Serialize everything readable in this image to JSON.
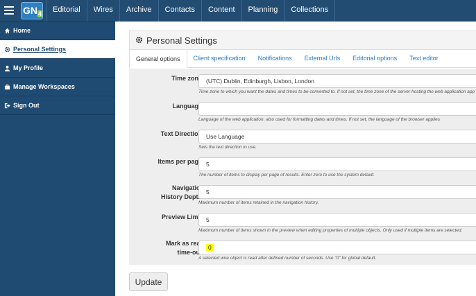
{
  "nav": {
    "logo": "GN",
    "logo_badge": "4",
    "items": [
      "Editorial",
      "Wires",
      "Archive",
      "Contacts",
      "Content",
      "Planning",
      "Collections"
    ]
  },
  "sidebar": {
    "items": [
      {
        "label": "Home",
        "icon": "home-icon"
      },
      {
        "label": "Personal Settings",
        "icon": "gear-icon",
        "active": true
      },
      {
        "label": "My Profile",
        "icon": "user-icon"
      },
      {
        "label": "Manage Workspaces",
        "icon": "briefcase-icon"
      },
      {
        "label": "Sign Out",
        "icon": "sign-out-icon"
      }
    ]
  },
  "panel": {
    "title": "Personal Settings"
  },
  "tabs": [
    "General options",
    "Client specification",
    "Notifications",
    "External Urls",
    "Editorial options",
    "Text editor"
  ],
  "fields": {
    "timezone": {
      "label": "Time zone:",
      "value": "(UTC) Dublin, Edinburgh, Lisbon, London",
      "hint": "Time zone to which you want the dates and times to be converted to. If not set, the time zone of the server hosting the web application app"
    },
    "language": {
      "label": "Language:",
      "value": "",
      "hint": "Language of the web application, also used for formatting dates and times. If not set, the language of the browser applies"
    },
    "text_direction": {
      "label": "Text Direction:",
      "value": "Use Language",
      "hint": "Sets the text direction to use."
    },
    "items_per_page": {
      "label": "Items per page:",
      "value": "5",
      "hint": "The number of items to display per page of results. Enter zero to use the system default."
    },
    "nav_history": {
      "label_line1": "Navigation",
      "label_line2": "History Depth:",
      "value": "5",
      "hint": "Maximum number of items retained in the navigation history."
    },
    "preview_limit": {
      "label": "Preview Limit:",
      "value": "5",
      "hint": "Maximum number of items shown in the preview when editing properties of multiple objects. Only used if multiple items are selected."
    },
    "mark_read": {
      "label_line1": "Mark as read",
      "label_line2": "time-out:",
      "value": "0",
      "hint": "A selected wire object is read after defined number of seconds. Use \"0\" for global default."
    }
  },
  "update_label": "Update"
}
